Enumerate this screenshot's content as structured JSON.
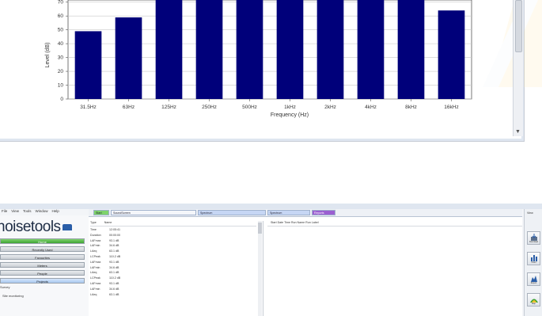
{
  "chart_data": {
    "type": "bar",
    "title": "",
    "xlabel": "Frequency (Hz)",
    "ylabel": "Level (dB)",
    "ylim": [
      0,
      75
    ],
    "yticks": [
      0,
      10,
      20,
      30,
      40,
      50,
      60,
      70
    ],
    "categories": [
      "31.5Hz",
      "63Hz",
      "125Hz",
      "250Hz",
      "500Hz",
      "1kHz",
      "2kHz",
      "4kHz",
      "8kHz",
      "16kHz"
    ],
    "values": [
      49,
      59,
      78,
      78,
      78,
      78,
      78,
      78,
      78,
      64
    ],
    "grid": true,
    "legend": "none",
    "bar_color": "#00007a"
  },
  "app": {
    "menu": [
      "File",
      "View",
      "Tools",
      "Window",
      "Help"
    ],
    "logo_text": "noisetools",
    "nav_buttons": [
      "Home",
      "Recently Used",
      "Favourites",
      "Meters",
      "People",
      "Projects"
    ],
    "tree_items": [
      "Survey",
      "Site monitoring"
    ],
    "tabs": [
      "Start",
      "SoundScreen",
      "Spectrum",
      "Spectrum",
      "Reports"
    ],
    "list_columns": [
      "Type",
      "Name"
    ],
    "list_rows": [
      [
        "Time",
        "12:05:41"
      ],
      [
        "Duration",
        "00:00:00"
      ],
      [
        "LAFmax",
        "93.1 dB"
      ],
      [
        "LAFmin",
        "34.6 dB"
      ],
      [
        "LAeq",
        "63.1 dB"
      ],
      [
        "LCPeak",
        "110.2 dB"
      ],
      [
        "LAFmax",
        "93.1 dB"
      ],
      [
        "LAFmin",
        "34.6 dB"
      ],
      [
        "LAeq",
        "63.1 dB"
      ],
      [
        "LCPeak",
        "110.2 dB"
      ],
      [
        "LAFmax",
        "93.1 dB"
      ],
      [
        "LAFmin",
        "34.6 dB"
      ],
      [
        "LAeq",
        "63.1 dB"
      ]
    ],
    "detail_header": "Start Date   Time   Run Name   Run   Label",
    "toolbar": {
      "view_label": "View",
      "tools": [
        "Download",
        "Chart",
        "Report",
        "Map"
      ]
    },
    "colors": {
      "accent_green": "#3ea334",
      "selection_blue": "#a9c8ef",
      "tab_highlight": "#9b5fd1"
    }
  }
}
